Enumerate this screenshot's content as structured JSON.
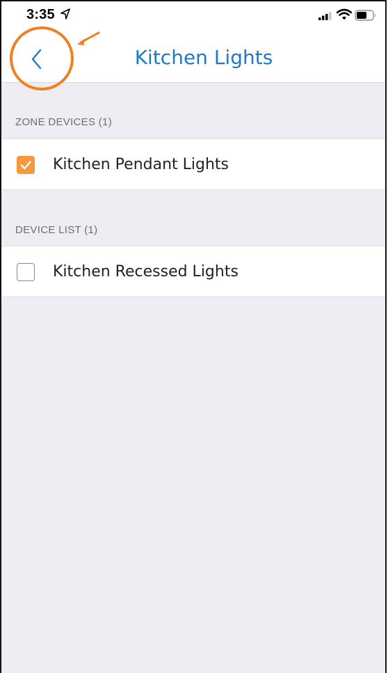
{
  "status_bar": {
    "time": "3:35"
  },
  "nav": {
    "title": "Kitchen Lights"
  },
  "sections": [
    {
      "header": "ZONE DEVICES (1)",
      "items": [
        {
          "label": "Kitchen Pendant Lights",
          "checked": true
        }
      ]
    },
    {
      "header": "DEVICE LIST (1)",
      "items": [
        {
          "label": "Kitchen Recessed Lights",
          "checked": false
        }
      ]
    }
  ],
  "colors": {
    "accent_blue": "#1e7ac8",
    "checkbox_orange": "#f39a3c",
    "background": "#efedf4",
    "annotation": "#f08020"
  },
  "icons": {
    "back": "chevron-left-icon",
    "location": "location-arrow-icon",
    "signal": "cellular-signal-icon",
    "wifi": "wifi-icon",
    "battery": "battery-icon",
    "check": "checkmark-icon"
  }
}
